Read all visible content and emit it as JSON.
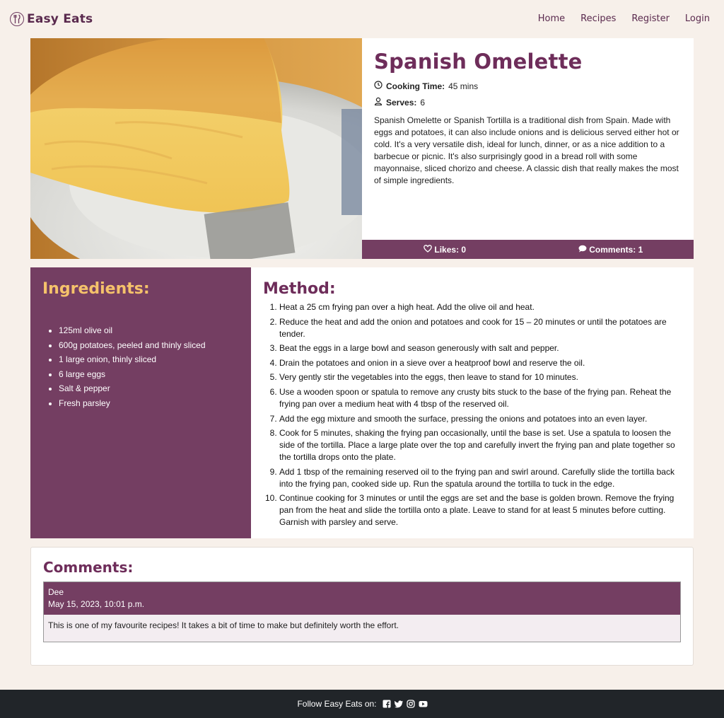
{
  "nav": {
    "brand": "Easy Eats",
    "links": [
      "Home",
      "Recipes",
      "Register",
      "Login"
    ]
  },
  "recipe": {
    "title": "Spanish Omelette",
    "cooking_time_label": "Cooking Time:",
    "cooking_time": "45 mins",
    "serves_label": "Serves:",
    "serves": "6",
    "description": "Spanish Omelette or Spanish Tortilla is a traditional dish from Spain. Made with eggs and potatoes, it can also include onions and is delicious served either hot or cold. It's a very versatile dish, ideal for lunch, dinner, or as a nice addition to a barbecue or picnic. It's also surprisingly good in a bread roll with some mayonnaise, sliced chorizo and cheese. A classic dish that really makes the most of simple ingredients.",
    "likes": "Likes: 0",
    "comments_count": "Comments: 1"
  },
  "ingredients": {
    "title": "Ingredients:",
    "items": [
      "125ml olive oil",
      "600g potatoes, peeled and thinly sliced",
      "1 large onion, thinly sliced",
      "6 large eggs",
      "Salt & pepper",
      "Fresh parsley"
    ]
  },
  "method": {
    "title": "Method:",
    "steps": [
      "Heat a 25 cm frying pan over a high heat. Add the olive oil and heat.",
      "Reduce the heat and add the onion and potatoes and cook for 15 – 20 minutes or until the potatoes are tender.",
      "Beat the eggs in a large bowl and season generously with salt and pepper.",
      "Drain the potatoes and onion in a sieve over a heatproof bowl and reserve the oil.",
      "Very gently stir the vegetables into the eggs, then leave to stand for 10 minutes.",
      "Use a wooden spoon or spatula to remove any crusty bits stuck to the base of the frying pan. Reheat the frying pan over a medium heat with 4 tbsp of the reserved oil.",
      "Add the egg mixture and smooth the surface, pressing the onions and potatoes into an even layer.",
      "Cook for 5 minutes, shaking the frying pan occasionally, until the base is set. Use a spatula to loosen the side of the tortilla. Place a large plate over the top and carefully invert the frying pan and plate together so the tortilla drops onto the plate.",
      "Add 1 tbsp of the remaining reserved oil to the frying pan and swirl around. Carefully slide the tortilla back into the frying pan, cooked side up. Run the spatula around the tortilla to tuck in the edge.",
      "Continue cooking for 3 minutes or until the eggs are set and the base is golden brown. Remove the frying pan from the heat and slide the tortilla onto a plate. Leave to stand for at least 5 minutes before cutting. Garnish with parsley and serve."
    ]
  },
  "comments": {
    "title": "Comments:",
    "items": [
      {
        "author": "Dee",
        "date": "May 15, 2023, 10:01 p.m.",
        "text": "This is one of my favourite recipes! It takes a bit of time to make but definitely worth the effort."
      }
    ]
  },
  "footer": {
    "follow": "Follow Easy Eats on:",
    "icons": [
      "facebook-icon",
      "twitter-icon",
      "instagram-icon",
      "youtube-icon"
    ]
  },
  "colors": {
    "plum": "#743e62",
    "title_plum": "#6e2d5a",
    "gold": "#f5c26b",
    "page_bg": "#f7f0ea",
    "footer_bg": "#212529"
  }
}
